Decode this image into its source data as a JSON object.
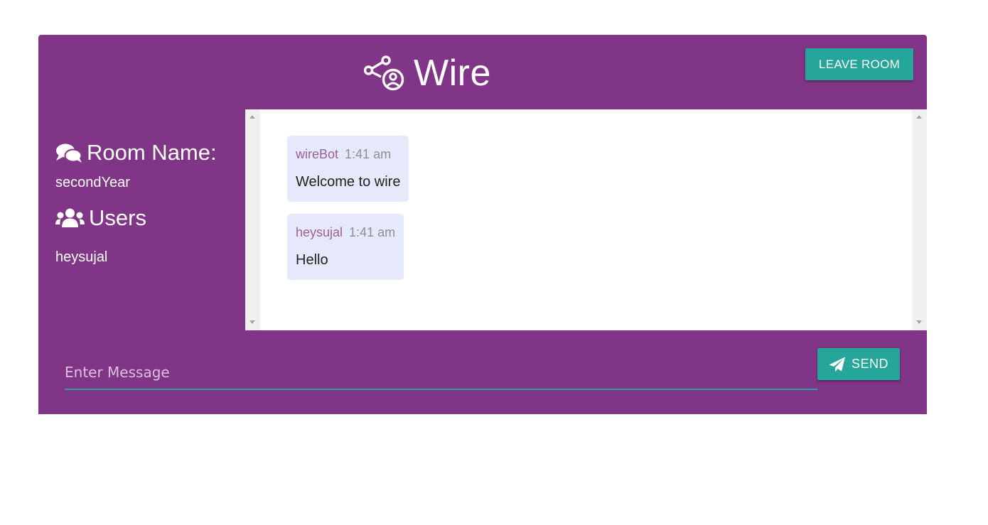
{
  "header": {
    "app_name": "Wire",
    "leave_button": "LEAVE ROOM",
    "icons": {
      "brand": "share-user-icon"
    }
  },
  "sidebar": {
    "room_heading": "Room Name:",
    "room_name": "secondYear",
    "users_heading": "Users",
    "users": [
      "heysujal"
    ],
    "icons": {
      "room": "comments-icon",
      "users": "users-icon"
    }
  },
  "chat": {
    "messages": [
      {
        "user": "wireBot",
        "time": "1:41 am",
        "text": "Welcome to wire"
      },
      {
        "user": "heysujal",
        "time": "1:41 am",
        "text": "Hello"
      }
    ]
  },
  "composer": {
    "placeholder": "Enter Message",
    "value": "",
    "send_label": "SEND",
    "icons": {
      "send": "paper-plane-icon"
    }
  },
  "colors": {
    "primary": "#813586",
    "accent": "#26a69a",
    "message_bg": "#e6e9fb",
    "username": "#9b5e9f",
    "timestamp": "#8f8f8f"
  }
}
